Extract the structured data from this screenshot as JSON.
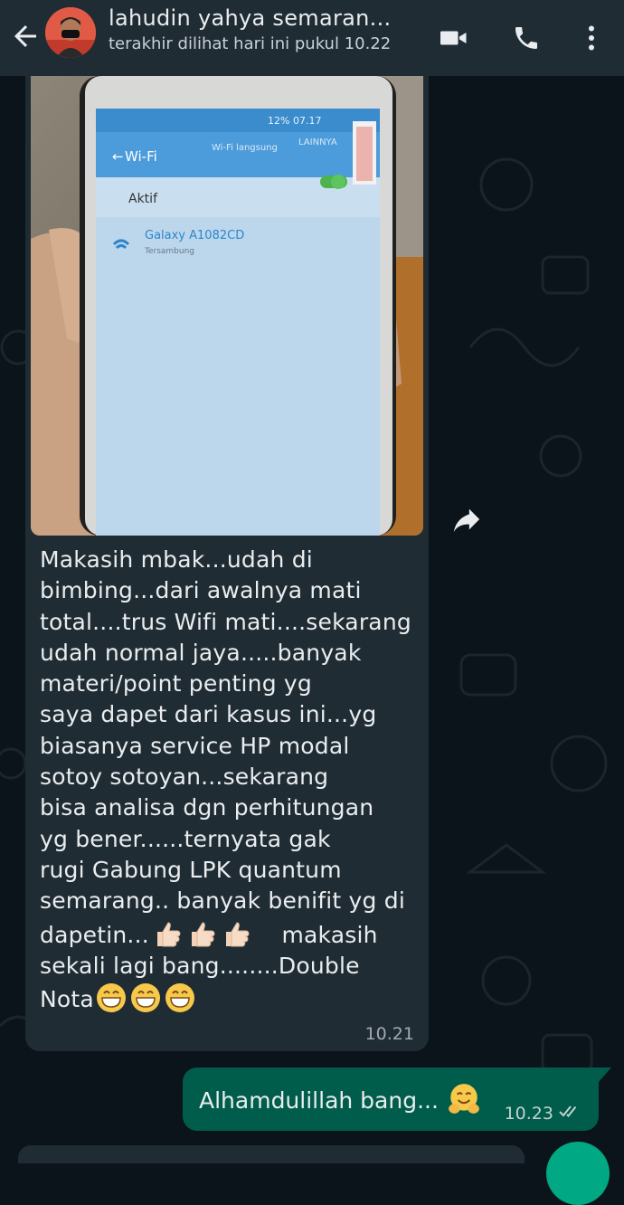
{
  "header": {
    "contact_name": "lahudin yahya semaran...",
    "last_seen": "terakhir dilihat hari ini pukul 10.22"
  },
  "messages": {
    "incoming": {
      "photo": {
        "status_bar": "12% 07.17",
        "screen_title": "Wi-Fi",
        "tab_direct": "Wi-Fi langsung",
        "tab_more": "LAINNYA",
        "toggle_label": "Aktif",
        "network_name": "Galaxy A1082CD",
        "network_status": "Tersambung"
      },
      "text": "Makasih mbak...udah di\nbimbing...dari awalnya mati\ntotal....trus Wifi mati....sekarang\nudah normal jaya.....banyak\nmateri/point penting yg\nsaya dapet dari kasus ini...yg\nbiasanya service HP modal\nsotoy sotoyan...sekarang\nbisa analisa dgn perhitungan\nyg bener......ternyata gak\nrugi Gabung LPK quantum\nsemarang.. banyak benifit yg di",
      "line_thumbs": "dapetin...",
      "line_thumbs_after": "makasih",
      "line_after": "sekali lagi bang........Double",
      "line_last": "Nota",
      "time": "10.21"
    },
    "outgoing": {
      "text": "Alhamdulillah bang...",
      "time": "10.23",
      "status": "read"
    }
  },
  "icons": {
    "back": "arrow-left-icon",
    "video": "video-call-icon",
    "voice": "phone-icon",
    "menu": "more-vert-icon",
    "forward": "forward-icon"
  },
  "colors": {
    "header_bg": "#1f2c34",
    "chat_bg": "#0b141a",
    "incoming_bubble": "#202c33",
    "outgoing_bubble": "#005c4b",
    "accent": "#00a884"
  }
}
